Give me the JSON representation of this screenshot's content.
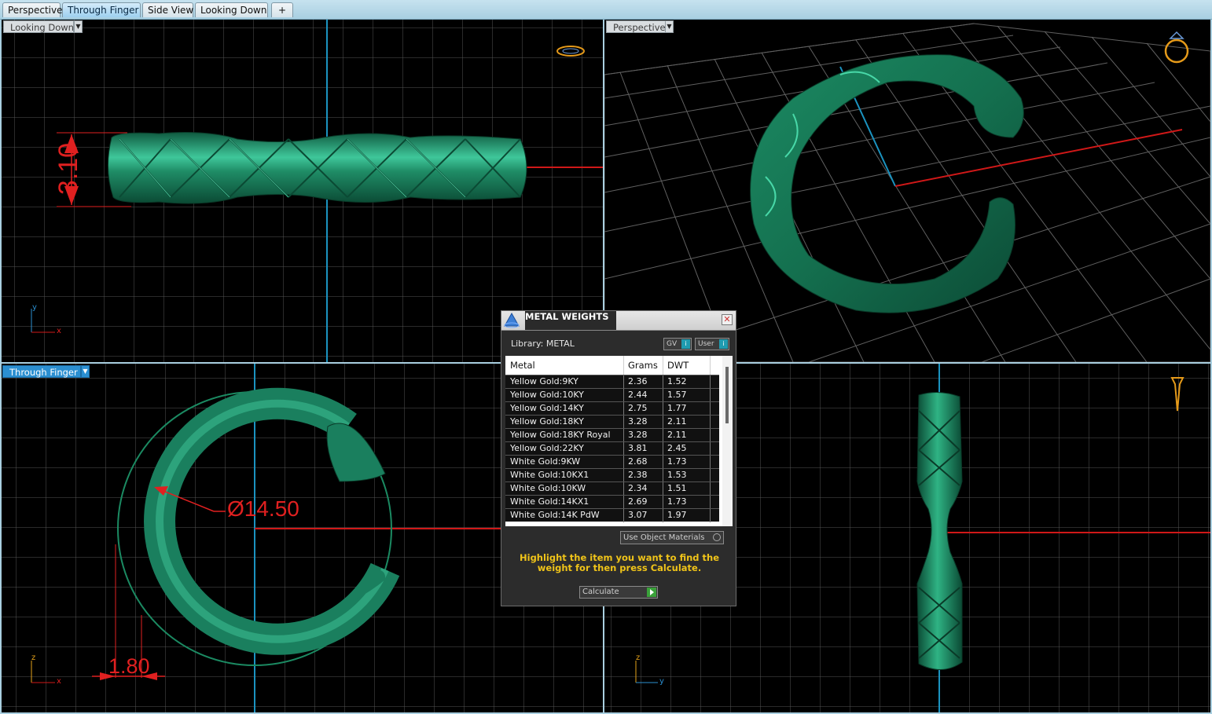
{
  "tabs": [
    {
      "label": "Perspective",
      "active": false
    },
    {
      "label": "Through Finger",
      "active": true
    },
    {
      "label": "Side View",
      "active": false
    },
    {
      "label": "Looking Down",
      "active": false
    }
  ],
  "add_tab_icon": "plus-icon",
  "viewports": {
    "top_left": {
      "label": "Looking Down",
      "dimension": "3.10",
      "axes": [
        "y",
        "x"
      ]
    },
    "top_right": {
      "label": "Perspective"
    },
    "bottom_left": {
      "label": "Through Finger",
      "diameter": "Ø14.50",
      "dimension": "1.80",
      "axes": [
        "z",
        "x"
      ]
    },
    "bottom_right": {
      "axes": [
        "z",
        "y"
      ]
    }
  },
  "colors": {
    "model": "#1a7f5e",
    "model_light": "#3fc79a",
    "grid": "#6a6a6a",
    "accent_blue": "#2b8fd1",
    "dimension_red": "#e02020",
    "hint_yellow": "#f0c419"
  },
  "dialog": {
    "title": "METAL WEIGHTS",
    "library": "Library: METAL",
    "gv_label": "GV",
    "user_label": "User",
    "columns": [
      "Metal",
      "Grams",
      "DWT"
    ],
    "rows": [
      [
        "Yellow Gold:9KY",
        "2.36",
        "1.52"
      ],
      [
        "Yellow Gold:10KY",
        "2.44",
        "1.57"
      ],
      [
        "Yellow Gold:14KY",
        "2.75",
        "1.77"
      ],
      [
        "Yellow Gold:18KY",
        "3.28",
        "2.11"
      ],
      [
        "Yellow Gold:18KY Royal",
        "3.28",
        "2.11"
      ],
      [
        "Yellow Gold:22KY",
        "3.81",
        "2.45"
      ],
      [
        "White Gold:9KW",
        "2.68",
        "1.73"
      ],
      [
        "White Gold:10KX1",
        "2.38",
        "1.53"
      ],
      [
        "White Gold:10KW",
        "2.34",
        "1.51"
      ],
      [
        "White Gold:14KX1",
        "2.69",
        "1.73"
      ],
      [
        "White Gold:14K PdW",
        "3.07",
        "1.97"
      ]
    ],
    "use_object_materials": "Use Object Materials",
    "hint": "Highlight the item you want to find the weight for then press Calculate.",
    "calculate_label": "Calculate"
  }
}
